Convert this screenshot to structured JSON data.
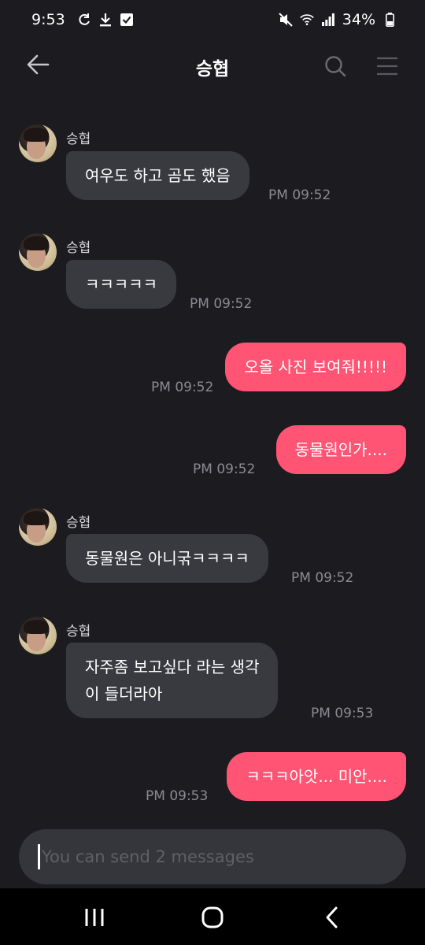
{
  "status_bar": {
    "time": "9:53",
    "battery": "34%",
    "icons": [
      "sync-icon",
      "download-icon",
      "checkbox-icon",
      "mute-icon",
      "wifi-icon",
      "signal-icon",
      "battery-icon"
    ]
  },
  "header": {
    "title": "승협",
    "icons": [
      "back-arrow-icon",
      "search-icon",
      "menu-icon"
    ]
  },
  "messages": [
    {
      "direction": "in",
      "sender": "승협",
      "text": "여우도 하고 곰도 했음",
      "time": "PM 09:52"
    },
    {
      "direction": "in",
      "sender": "승협",
      "text": "ㅋㅋㅋㅋㅋ",
      "time": "PM 09:52"
    },
    {
      "direction": "out",
      "text": "오올 사진 보여줘!!!!!",
      "time": "PM 09:52"
    },
    {
      "direction": "out",
      "text": "동물원인가....",
      "time": "PM 09:52"
    },
    {
      "direction": "in",
      "sender": "승협",
      "text": "동물원은 아니굮ㅋㅋㅋㅋ",
      "time": "PM 09:52"
    },
    {
      "direction": "in",
      "sender": "승협",
      "text_line1": "자주좀 보고싶다 라는 생각",
      "text_line2": "이 들더라아",
      "time": "PM 09:53"
    },
    {
      "direction": "out",
      "text": "ㅋㅋㅋ아앗... 미안....",
      "time": "PM 09:53"
    }
  ],
  "input": {
    "placeholder": "You can send 2 messages",
    "value": ""
  },
  "colors": {
    "background": "#1c1c20",
    "incoming_bubble": "#383a40",
    "outgoing_bubble": "#ff5473",
    "timestamp": "#8a8a90"
  },
  "nav_bar": {
    "icons": [
      "recents-icon",
      "home-icon",
      "back-icon"
    ]
  }
}
